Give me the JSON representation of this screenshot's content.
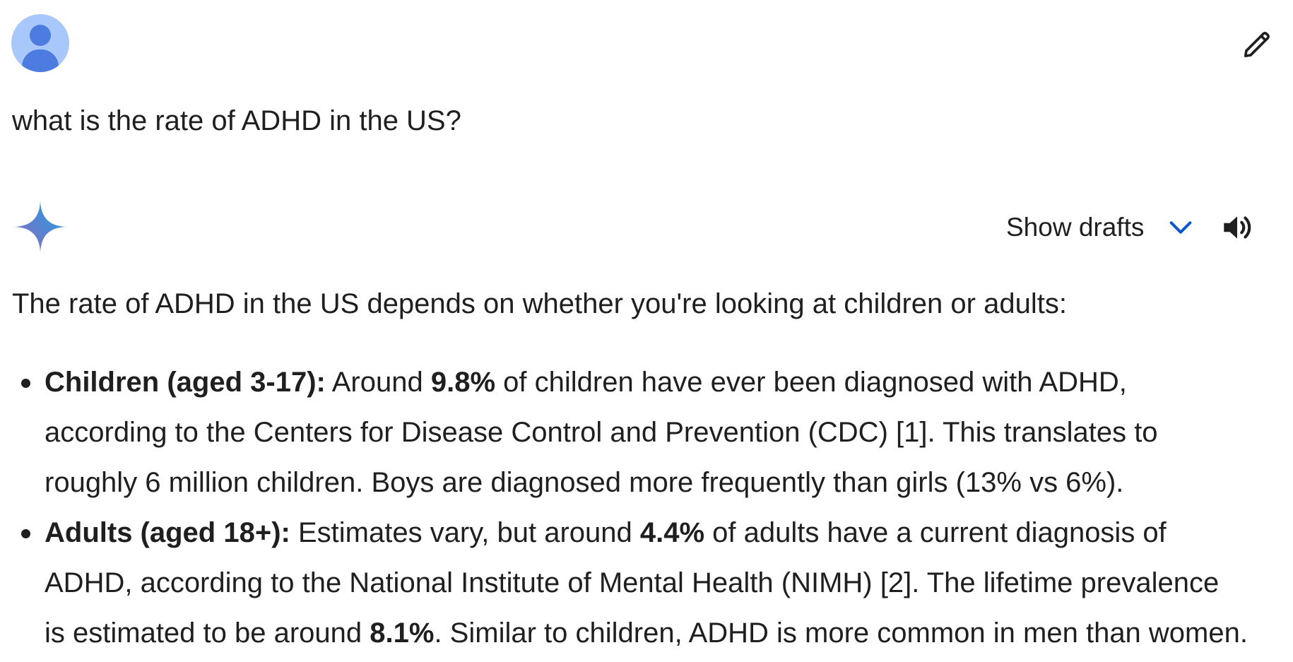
{
  "user": {
    "query": "what is the rate of ADHD in the US?",
    "avatar_icon": "user-avatar-icon",
    "edit_icon": "pencil-icon"
  },
  "response": {
    "logo_icon": "gemini-spark-icon",
    "show_drafts_label": "Show drafts",
    "chevron_icon": "chevron-down-icon",
    "speaker_icon": "speaker-icon",
    "intro": "The rate of ADHD in the US depends on whether you're looking at children or adults:",
    "bullets": [
      {
        "heading": "Children (aged 3-17):",
        "line1_a": " Around ",
        "stat1": "9.8%",
        "line1_b": " of children have ever been diagnosed with ADHD,",
        "line2": "according to the Centers for Disease Control and Prevention (CDC) [1]. This translates to",
        "line3": "roughly 6 million children. Boys are diagnosed more frequently than girls (13% vs 6%)."
      },
      {
        "heading": "Adults (aged 18+):",
        "line1_a": " Estimates vary, but around ",
        "stat1": "4.4%",
        "line1_b": " of adults have a current diagnosis of",
        "line2": "ADHD, according to the National Institute of Mental Health (NIMH) [2]. The lifetime prevalence",
        "line3_a": "is estimated to be around ",
        "stat2": "8.1%",
        "line3_b": ". Similar to children, ADHD is more common in men than women."
      }
    ]
  },
  "colors": {
    "accent_blue": "#0b57d0",
    "avatar_bg": "#a8c7fa",
    "avatar_fg": "#4c7ce0",
    "text": "#1f1f1f"
  }
}
